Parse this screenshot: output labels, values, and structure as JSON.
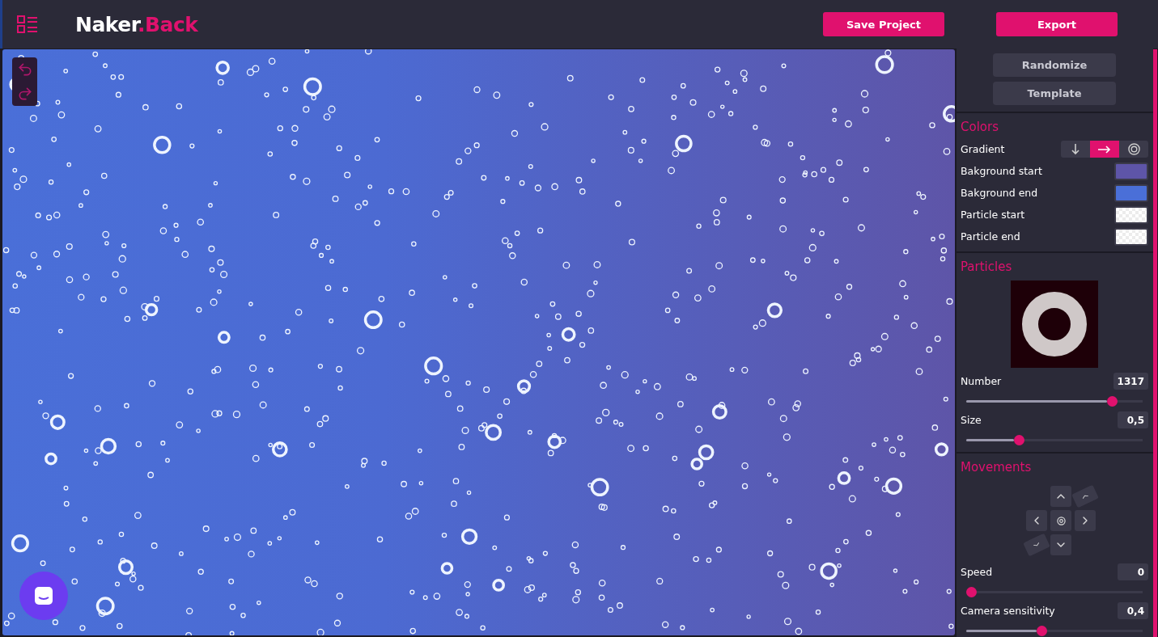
{
  "header": {
    "logo_main": "Naker",
    "logo_accent": ".Back",
    "buttons": [
      "Save Project",
      "Export"
    ]
  },
  "sidebar": {
    "actions": [
      "Randomize",
      "Template"
    ],
    "colors": {
      "title": "Colors",
      "gradient_label": "Gradient",
      "gradient_options": [
        {
          "kind": "vertical",
          "selected": false
        },
        {
          "kind": "horizontal",
          "selected": true
        },
        {
          "kind": "radial",
          "selected": false
        }
      ],
      "rows": [
        {
          "label": "Bakground start",
          "kind": "solid",
          "color": "#5e55a8"
        },
        {
          "label": "Bakground end",
          "kind": "solid",
          "color": "#4a6fd8"
        },
        {
          "label": "Particle start",
          "kind": "transparent"
        },
        {
          "label": "Particle end",
          "kind": "transparent"
        }
      ]
    },
    "particles": {
      "title": "Particles",
      "sliders": [
        {
          "label": "Number",
          "reading": "1317",
          "level": 0.8
        },
        {
          "label": "Size",
          "reading": "0,5",
          "level": 0.27
        }
      ]
    },
    "movements": {
      "title": "Movements",
      "sliders": [
        {
          "label": "Speed",
          "reading": "0",
          "level": 0.0
        },
        {
          "label": "Camera sensitivity",
          "reading": "0,4",
          "level": 0.4
        }
      ]
    }
  }
}
